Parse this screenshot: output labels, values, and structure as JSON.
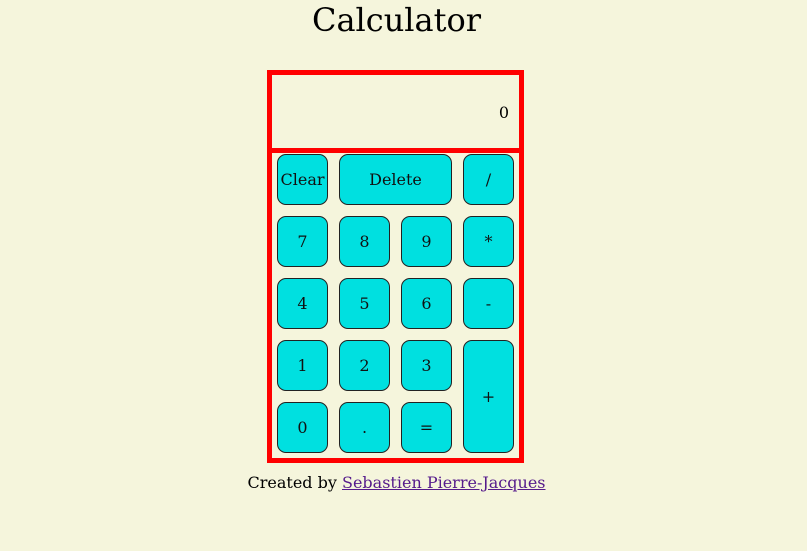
{
  "title": "Calculator",
  "display": {
    "value": "0"
  },
  "buttons": {
    "clear": "Clear",
    "delete": "Delete",
    "divide": "/",
    "seven": "7",
    "eight": "8",
    "nine": "9",
    "multiply": "*",
    "four": "4",
    "five": "5",
    "six": "6",
    "subtract": "-",
    "one": "1",
    "two": "2",
    "three": "3",
    "add": "+",
    "zero": "0",
    "decimal": ".",
    "equals": "="
  },
  "footer": {
    "prefix": "Created by ",
    "author": "Sebastien Pierre-Jacques"
  },
  "colors": {
    "background": "#f5f5dc",
    "border": "#ff0000",
    "button": "#00e0e0",
    "link": "#551a8b"
  }
}
